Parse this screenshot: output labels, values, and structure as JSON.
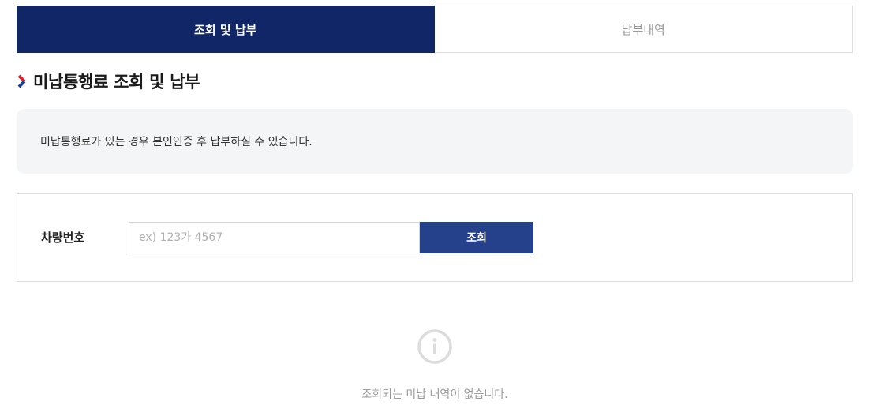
{
  "tabs": [
    {
      "label": "조회 및 납부",
      "active": true
    },
    {
      "label": "납부내역",
      "active": false
    }
  ],
  "page": {
    "title": "미납통행료 조회 및 납부",
    "title_icon": "chevron-right-icon"
  },
  "notice": {
    "text": "미납통행료가 있는 경우 본인인증 후 납부하실 수 있습니다."
  },
  "search": {
    "label": "차량번호",
    "value": "",
    "placeholder": "ex) 123가 4567",
    "button_label": "조회"
  },
  "empty_state": {
    "icon": "info-icon",
    "message": "조회되는 미납 내역이 없습니다."
  },
  "colors": {
    "primary_dark": "#112667",
    "button_blue": "#26418c",
    "chevron_red": "#d7262e",
    "chevron_blue": "#1c3f94",
    "panel_bg": "#f4f5f7",
    "muted_text": "#999999"
  }
}
